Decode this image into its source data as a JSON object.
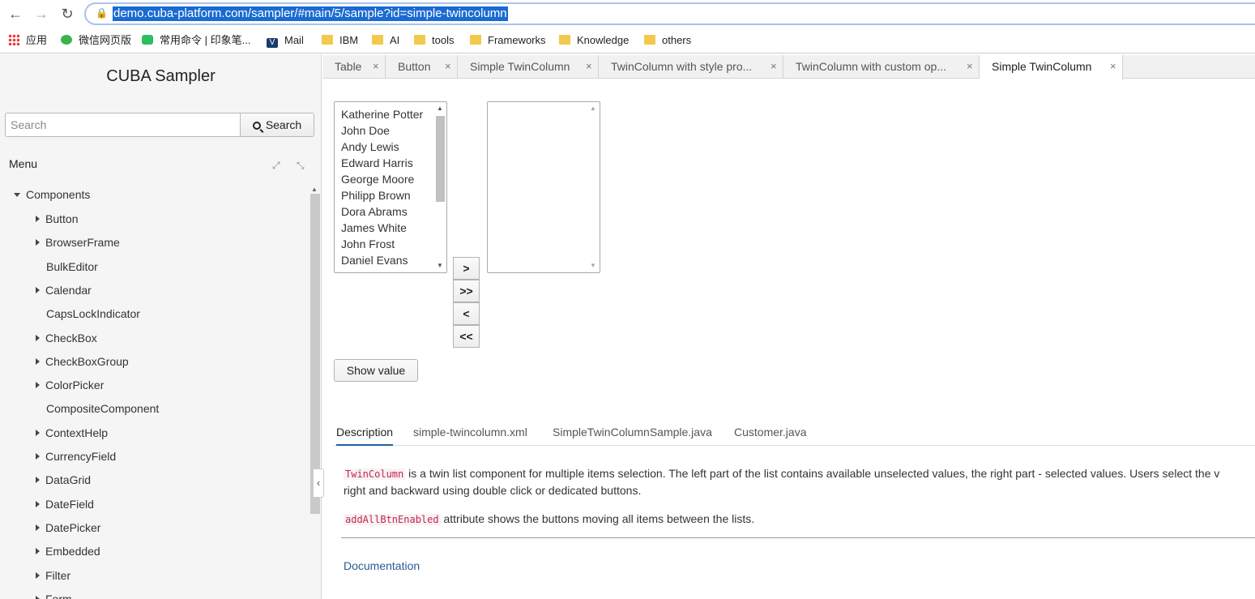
{
  "browser": {
    "url": "demo.cuba-platform.com/sampler/#main/5/sample?id=simple-twincolumn",
    "bookmarks": [
      "应用",
      "微信网页版",
      "常用命令 | 印象笔...",
      "Mail",
      "IBM",
      "AI",
      "tools",
      "Frameworks",
      "Knowledge",
      "others"
    ]
  },
  "sidebar": {
    "title": "CUBA Sampler",
    "search_placeholder": "Search",
    "search_button": "Search",
    "menu_label": "Menu",
    "tree_root": "Components",
    "tree_items": [
      {
        "label": "Button",
        "expandable": true
      },
      {
        "label": "BrowserFrame",
        "expandable": true
      },
      {
        "label": "BulkEditor",
        "expandable": false
      },
      {
        "label": "Calendar",
        "expandable": true
      },
      {
        "label": "CapsLockIndicator",
        "expandable": false
      },
      {
        "label": "CheckBox",
        "expandable": true
      },
      {
        "label": "CheckBoxGroup",
        "expandable": true
      },
      {
        "label": "ColorPicker",
        "expandable": true
      },
      {
        "label": "CompositeComponent",
        "expandable": false
      },
      {
        "label": "ContextHelp",
        "expandable": true
      },
      {
        "label": "CurrencyField",
        "expandable": true
      },
      {
        "label": "DataGrid",
        "expandable": true
      },
      {
        "label": "DateField",
        "expandable": true
      },
      {
        "label": "DatePicker",
        "expandable": true
      },
      {
        "label": "Embedded",
        "expandable": true
      },
      {
        "label": "Filter",
        "expandable": true
      },
      {
        "label": "Form",
        "expandable": true
      }
    ]
  },
  "tabs": [
    {
      "label": "Table",
      "active": false
    },
    {
      "label": "Button",
      "active": false
    },
    {
      "label": "Simple TwinColumn",
      "active": false
    },
    {
      "label": "TwinColumn with style pro...",
      "active": false
    },
    {
      "label": "TwinColumn with custom op...",
      "active": false
    },
    {
      "label": "Simple TwinColumn",
      "active": true
    }
  ],
  "twincolumn": {
    "available": [
      "Katherine Potter",
      "John Doe",
      "Andy Lewis",
      "Edward Harris",
      "George Moore",
      "Philipp Brown",
      "Dora Abrams",
      "James White",
      "John Frost",
      "Daniel Evans"
    ],
    "selected": [],
    "buttons": [
      ">",
      ">>",
      "<",
      "<<"
    ]
  },
  "show_value_button": "Show value",
  "description_tabs": [
    {
      "label": "Description",
      "active": true
    },
    {
      "label": "simple-twincolumn.xml",
      "active": false
    },
    {
      "label": "SimpleTwinColumnSample.java",
      "active": false
    },
    {
      "label": "Customer.java",
      "active": false
    }
  ],
  "description": {
    "p1_code": "TwinColumn",
    "p1_text": " is a twin list component for multiple items selection. The left part of the list contains available unselected values, the right part - selected values. Users select the v",
    "p1_line2": "right and backward using double click or dedicated buttons.",
    "p2_code": "addAllBtnEnabled",
    "p2_text": " attribute shows the buttons moving all items between the lists.",
    "doc_link": "Documentation"
  }
}
